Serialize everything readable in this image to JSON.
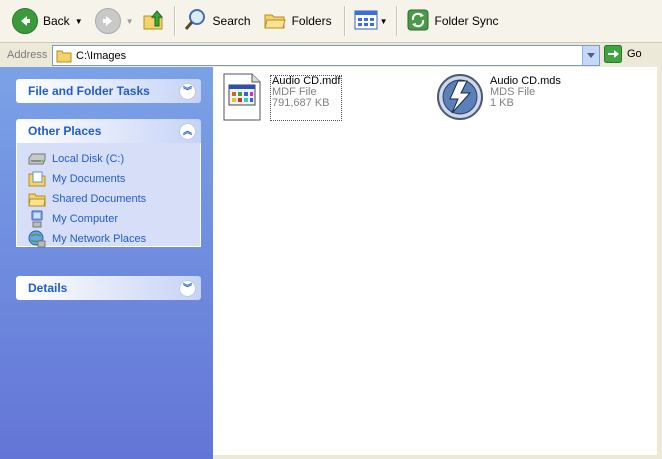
{
  "toolbar": {
    "back_label": "Back",
    "search_label": "Search",
    "folders_label": "Folders",
    "folder_sync_label": "Folder Sync"
  },
  "address": {
    "label": "Address",
    "path": "C:\\Images",
    "go_label": "Go"
  },
  "left_pane": {
    "file_tasks_title": "File and Folder Tasks",
    "other_places_title": "Other Places",
    "other_places": [
      {
        "label": "Local Disk (C:)",
        "icon": "disk-icon"
      },
      {
        "label": "My Documents",
        "icon": "documents-icon"
      },
      {
        "label": "Shared Documents",
        "icon": "folder-icon"
      },
      {
        "label": "My Computer",
        "icon": "computer-icon"
      },
      {
        "label": "My Network Places",
        "icon": "network-icon"
      }
    ],
    "details_title": "Details"
  },
  "files": [
    {
      "name": "Audio CD.mdf",
      "type": "MDF File",
      "size": "791,687 KB",
      "icon": "mdf-file-icon"
    },
    {
      "name": "Audio CD.mds",
      "type": "MDS File",
      "size": "1 KB",
      "icon": "daemon-tools-icon"
    }
  ],
  "colors": {
    "task_title": "#215dc6",
    "pane_top": "#7ba2e7",
    "pane_bottom": "#6375d6"
  }
}
